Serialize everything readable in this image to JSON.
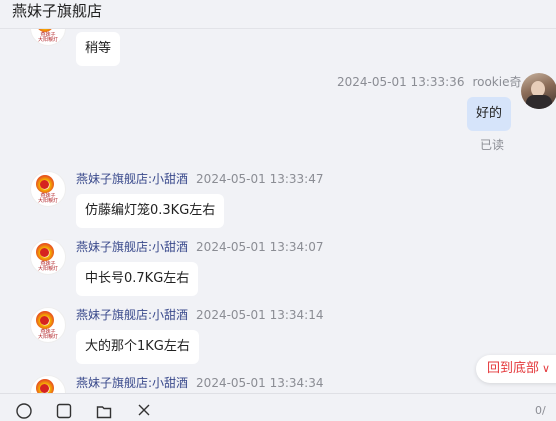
{
  "header": {
    "title": "燕妹子旗舰店"
  },
  "avatars": {
    "shop_line1": "燕妹子",
    "shop_line2": "大阳粮灯"
  },
  "messages": [
    {
      "side": "left",
      "sender": "",
      "time": "",
      "text": "稍等"
    },
    {
      "side": "right",
      "sender": "rookie奇",
      "time": "2024-05-01 13:33:36",
      "text": "好的",
      "status": "已读"
    },
    {
      "side": "left",
      "sender": "燕妹子旗舰店:小甜酒",
      "time": "2024-05-01 13:33:47",
      "text": "仿藤编灯笼0.3KG左右"
    },
    {
      "side": "left",
      "sender": "燕妹子旗舰店:小甜酒",
      "time": "2024-05-01 13:34:07",
      "text": "中长号0.7KG左右"
    },
    {
      "side": "left",
      "sender": "燕妹子旗舰店:小甜酒",
      "time": "2024-05-01 13:34:14",
      "text": "大的那个1KG左右"
    },
    {
      "side": "left",
      "sender": "燕妹子旗舰店:小甜酒",
      "time": "2024-05-01 13:34:34",
      "text": ""
    }
  ],
  "back_to_bottom": {
    "label": "回到底部"
  },
  "toolbar": {
    "icons": [
      "emoji-icon",
      "image-icon",
      "folder-icon",
      "scissors-icon"
    ],
    "counter": "0/"
  },
  "colors": {
    "background": "#f1f2f6",
    "self_bubble": "#d6e4fa",
    "accent": "#e4393c",
    "sender": "#3a4a8c"
  }
}
